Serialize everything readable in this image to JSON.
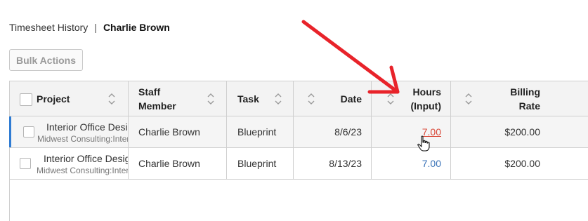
{
  "breadcrumb": {
    "section": "Timesheet History",
    "separator": "|",
    "user": "Charlie Brown"
  },
  "toolbar": {
    "bulk_actions_label": "Bulk Actions"
  },
  "table": {
    "columns": {
      "project": "Project",
      "staff_line1": "Staff",
      "staff_line2": "Member",
      "task": "Task",
      "date": "Date",
      "hours_line1": "Hours",
      "hours_line2": "(Input)",
      "rate_line1": "Billing",
      "rate_line2": "Rate"
    },
    "rows": [
      {
        "project": "Interior Office Design",
        "client": "Midwest Consulting:Interior",
        "staff": "Charlie Brown",
        "task": "Blueprint",
        "date": "8/6/23",
        "hours": "7.00",
        "rate": "$200.00"
      },
      {
        "project": "Interior Office Design",
        "client": "Midwest Consulting:Interior",
        "staff": "Charlie Brown",
        "task": "Blueprint",
        "date": "8/13/23",
        "hours": "7.00",
        "rate": "$200.00"
      }
    ]
  },
  "colors": {
    "annotation_arrow": "#e8232a",
    "link_hover": "#d94a3a",
    "link": "#3a73b8",
    "selected_marker": "#2f7cd3"
  },
  "icons": {
    "sort": "sort-up-down-icon",
    "cursor": "hand-pointer-icon",
    "annotation": "red-arrow"
  }
}
